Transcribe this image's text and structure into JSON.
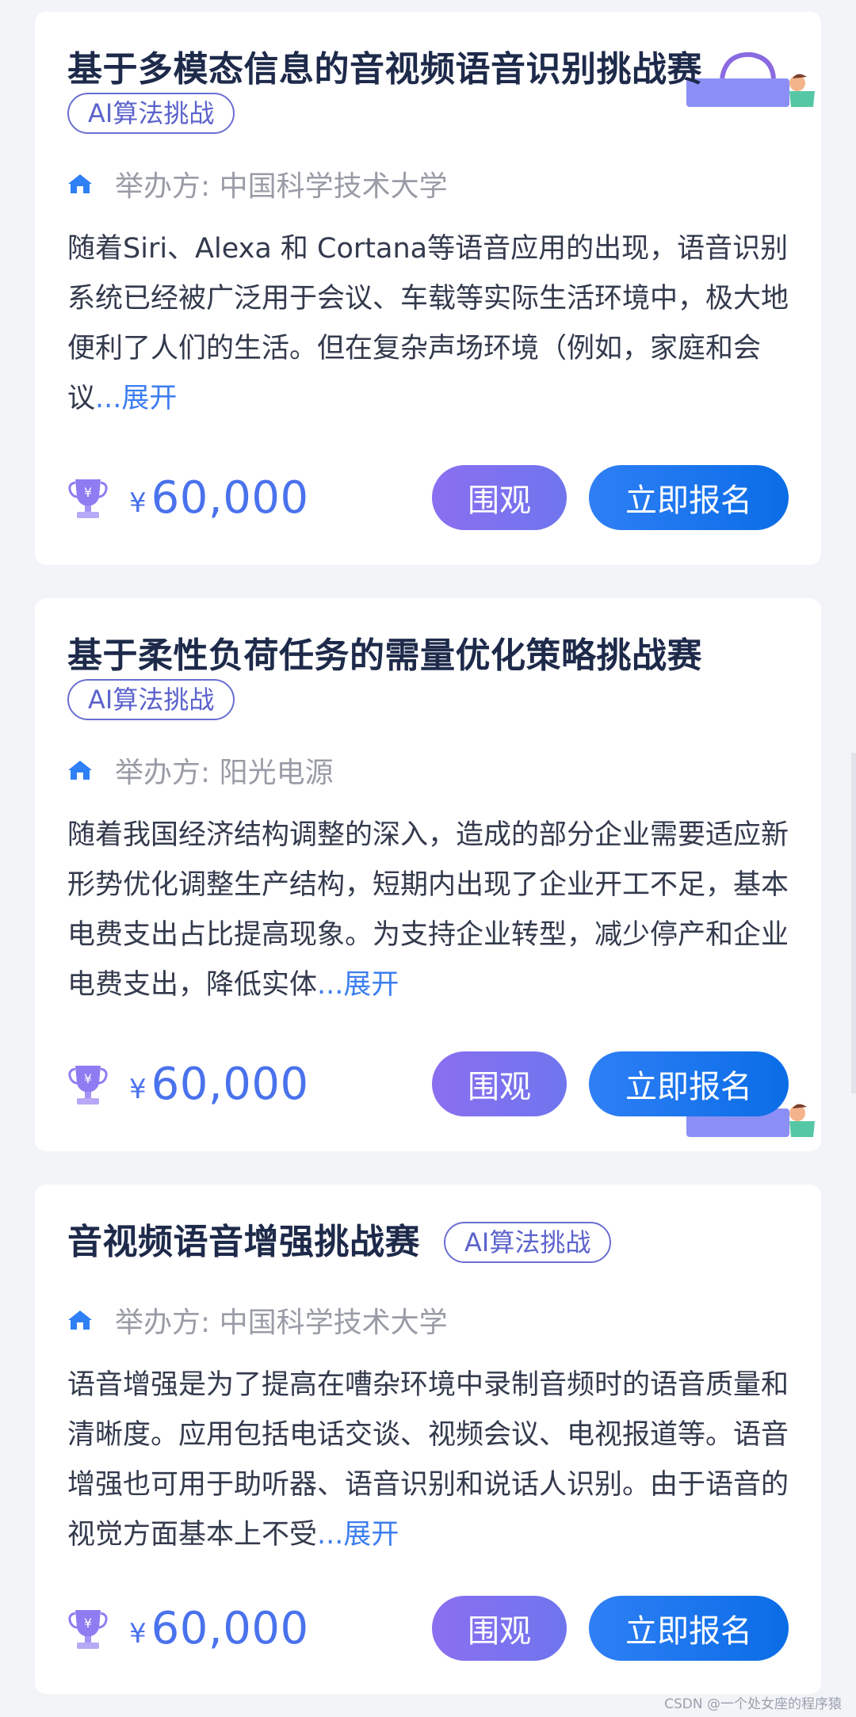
{
  "cards": [
    {
      "title": "基于多模态信息的音视频语音识别挑战赛",
      "tag": "AI算法挑战",
      "organizer": "举办方: 中国科学技术大学",
      "description": "随着Siri、Alexa 和 Cortana等语音应用的出现，语音识别系统已经被广泛用于会议、车载等实际生活环境中，极大地便利了人们的生活。但在复杂声场环境（例如，家庭和会议",
      "expand": "...展开",
      "currency": "¥",
      "prize": "60,000",
      "watch_label": "围观",
      "signup_label": "立即报名"
    },
    {
      "title": "基于柔性负荷任务的需量优化策略挑战赛",
      "tag": "AI算法挑战",
      "organizer": "举办方: 阳光电源",
      "description": "随着我国经济结构调整的深入，造成的部分企业需要适应新形势优化调整生产结构，短期内出现了企业开工不足，基本电费支出占比提高现象。为支持企业转型，减少停产和企业电费支出，降低实体",
      "expand": "...展开",
      "currency": "¥",
      "prize": "60,000",
      "watch_label": "围观",
      "signup_label": "立即报名"
    },
    {
      "title": "音视频语音增强挑战赛",
      "tag": "AI算法挑战",
      "organizer": "举办方: 中国科学技术大学",
      "description": "语音增强是为了提高在嘈杂环境中录制音频时的语音质量和清晰度。应用包括电话交谈、视频会议、电视报道等。语音增强也可用于助听器、语音识别和说话人识别。由于语音的视觉方面基本上不受",
      "expand": "...展开",
      "currency": "¥",
      "prize": "60,000",
      "watch_label": "围观",
      "signup_label": "立即报名"
    }
  ],
  "watermark": "CSDN @一个处女座的程序猿",
  "colors": {
    "background": "#f2f4f8",
    "title": "#1e2a4a",
    "accent_blue": "#4a72ec",
    "tag_purple": "#5c63cc",
    "watch_gradient": "#8a6ff0",
    "signup_gradient": "#0a6de6"
  },
  "icons": [
    "home-icon",
    "trophy-icon",
    "illustration-decoration"
  ]
}
